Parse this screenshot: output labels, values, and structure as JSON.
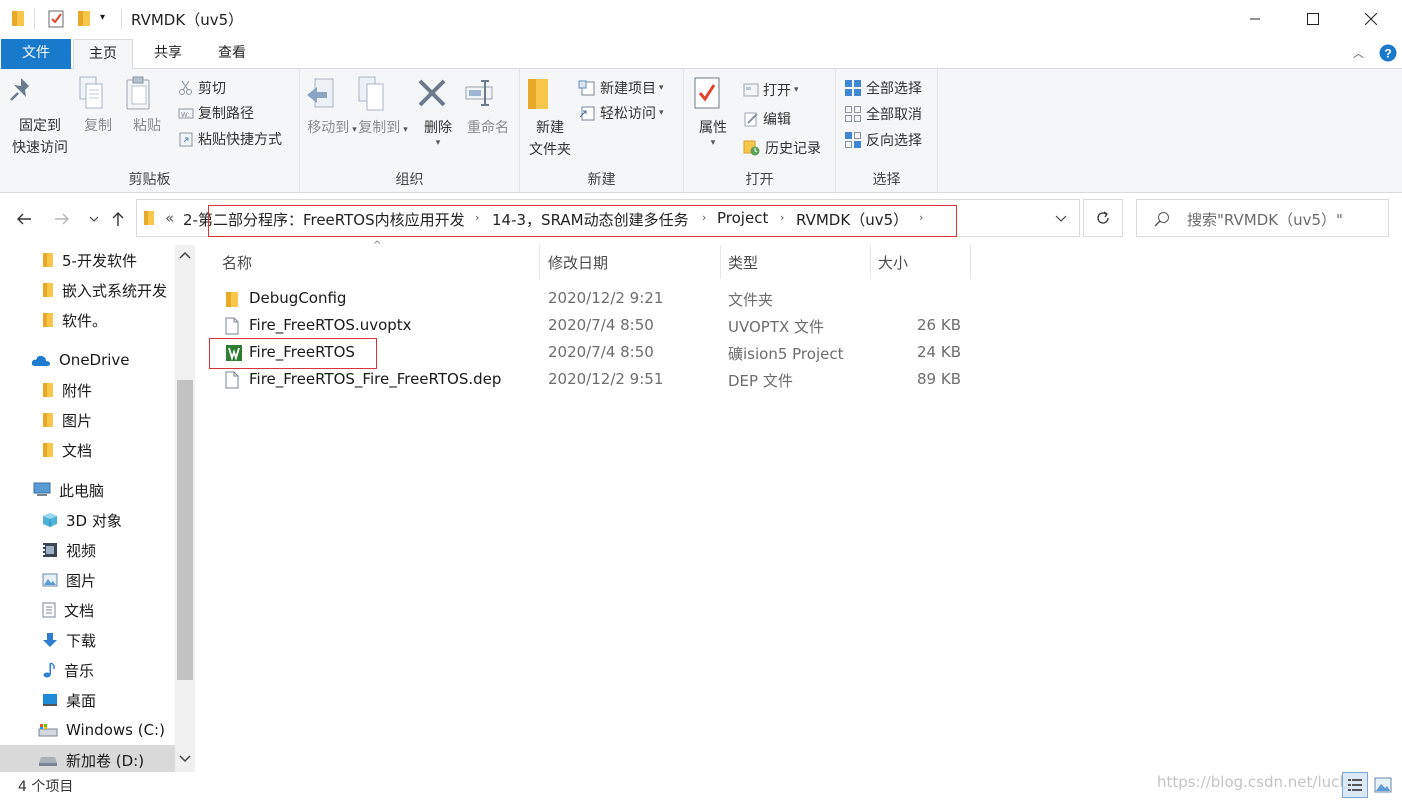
{
  "window": {
    "title": "RVMDK（uv5）",
    "controls": [
      "minimize-icon",
      "maximize-icon",
      "close-icon"
    ]
  },
  "tabs": {
    "file": "文件",
    "home": "主页",
    "share": "共享",
    "view": "查看"
  },
  "ribbon": {
    "clipboard": {
      "label": "剪贴板",
      "pin": "固定到\n快速访问",
      "pin_line1": "固定到",
      "pin_line2": "快速访问",
      "copy": "复制",
      "paste": "粘贴",
      "cut": "剪切",
      "copy_path": "复制路径",
      "paste_shortcut": "粘贴快捷方式"
    },
    "organize": {
      "label": "组织",
      "move_to": "移动到",
      "copy_to": "复制到",
      "delete": "删除",
      "rename": "重命名"
    },
    "new": {
      "label": "新建",
      "new_folder_line1": "新建",
      "new_folder_line2": "文件夹",
      "new_item": "新建项目",
      "easy_access": "轻松访问"
    },
    "open": {
      "label": "打开",
      "properties": "属性",
      "open": "打开",
      "edit": "编辑",
      "history": "历史记录"
    },
    "select": {
      "label": "选择",
      "select_all": "全部选择",
      "select_none": "全部取消",
      "invert": "反向选择"
    }
  },
  "address": {
    "overflow": "«",
    "crumbs": [
      "2-第二部分程序：FreeRTOS内核应用开发",
      "14-3，SRAM动态创建多任务",
      "Project",
      "RVMDK（uv5）"
    ],
    "highlight_color": "#d9343a"
  },
  "search": {
    "placeholder": "搜索\"RVMDK（uv5）\""
  },
  "nav": {
    "items": [
      {
        "label": "5-开发软件",
        "icon": "folder-icon"
      },
      {
        "label": "嵌入式系统开发",
        "icon": "folder-icon"
      },
      {
        "label": "软件。",
        "icon": "folder-icon"
      },
      {
        "label": "OneDrive",
        "icon": "onedrive-icon"
      },
      {
        "label": "附件",
        "icon": "folder-icon"
      },
      {
        "label": "图片",
        "icon": "folder-icon"
      },
      {
        "label": "文档",
        "icon": "folder-icon"
      },
      {
        "label": "此电脑",
        "icon": "computer-icon"
      },
      {
        "label": "3D 对象",
        "icon": "3d-objects-icon"
      },
      {
        "label": "视频",
        "icon": "video-icon"
      },
      {
        "label": "图片",
        "icon": "pictures-icon"
      },
      {
        "label": "文档",
        "icon": "documents-icon"
      },
      {
        "label": "下载",
        "icon": "download-icon"
      },
      {
        "label": "音乐",
        "icon": "music-icon"
      },
      {
        "label": "桌面",
        "icon": "desktop-icon"
      },
      {
        "label": "Windows (C:)",
        "icon": "drive-c-icon"
      },
      {
        "label": "新加卷 (D:)",
        "icon": "drive-icon"
      }
    ]
  },
  "columns": {
    "name": "名称",
    "date": "修改日期",
    "type": "类型",
    "size": "大小"
  },
  "files": [
    {
      "name": "DebugConfig",
      "date": "2020/12/2 9:21",
      "type": "文件夹",
      "size": "",
      "icon": "folder-icon"
    },
    {
      "name": "Fire_FreeRTOS.uvoptx",
      "date": "2020/7/4 8:50",
      "type": "UVOPTX 文件",
      "size": "26 KB",
      "icon": "file-icon"
    },
    {
      "name": "Fire_FreeRTOS",
      "date": "2020/7/4 8:50",
      "type": "礦ision5 Project",
      "size": "24 KB",
      "icon": "keil-project-icon"
    },
    {
      "name": "Fire_FreeRTOS_Fire_FreeRTOS.dep",
      "date": "2020/12/2 9:51",
      "type": "DEP 文件",
      "size": "89 KB",
      "icon": "file-icon"
    }
  ],
  "status": {
    "count": "4 个项目",
    "watermark": "https://blog.csdn.net/lucky"
  },
  "colors": {
    "file_tab": "#1979ca",
    "folder": "#f8c64b",
    "highlight_box": "#d9343a"
  }
}
